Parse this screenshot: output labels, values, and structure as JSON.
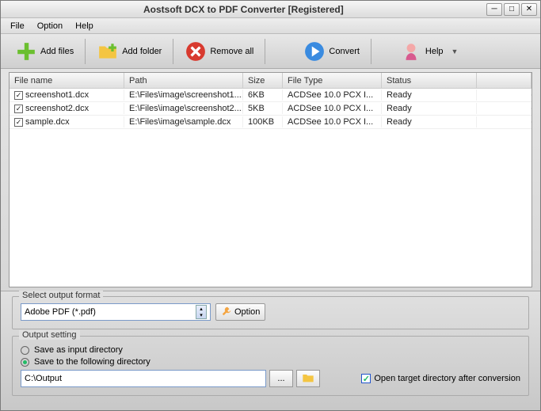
{
  "title": "Aostsoft DCX to PDF Converter [Registered]",
  "menu": {
    "file": "File",
    "option": "Option",
    "help": "Help"
  },
  "toolbar": {
    "add_files": "Add files",
    "add_folder": "Add folder",
    "remove_all": "Remove all",
    "convert": "Convert",
    "help": "Help"
  },
  "columns": {
    "filename": "File name",
    "path": "Path",
    "size": "Size",
    "filetype": "File Type",
    "status": "Status"
  },
  "rows": [
    {
      "checked": true,
      "filename": "screenshot1.dcx",
      "path": "E:\\Files\\image\\screenshot1....",
      "size": "6KB",
      "filetype": "ACDSee 10.0 PCX I...",
      "status": "Ready"
    },
    {
      "checked": true,
      "filename": "screenshot2.dcx",
      "path": "E:\\Files\\image\\screenshot2....",
      "size": "5KB",
      "filetype": "ACDSee 10.0 PCX I...",
      "status": "Ready"
    },
    {
      "checked": true,
      "filename": "sample.dcx",
      "path": "E:\\Files\\image\\sample.dcx",
      "size": "100KB",
      "filetype": "ACDSee 10.0 PCX I...",
      "status": "Ready"
    }
  ],
  "output_format": {
    "legend": "Select output format",
    "value": "Adobe PDF (*.pdf)",
    "option_btn": "Option"
  },
  "output_setting": {
    "legend": "Output setting",
    "radio_input": "Save as input directory",
    "radio_following": "Save to the following directory",
    "path": "C:\\Output",
    "browse": "...",
    "open_after": "Open target directory after conversion"
  }
}
